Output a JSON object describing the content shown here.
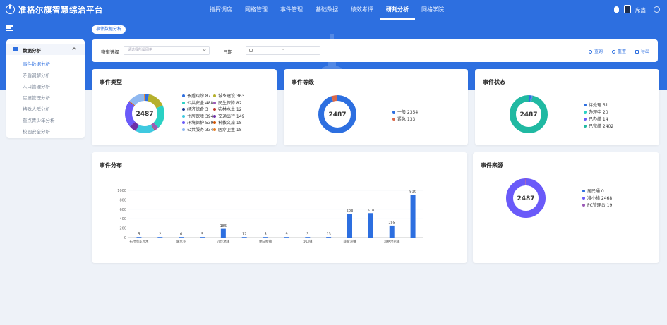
{
  "header": {
    "title": "准格尔旗智慧综治平台",
    "nav": [
      "指挥调度",
      "网格管理",
      "事件管理",
      "基础数据",
      "绩效考评",
      "研判分析",
      "网格学院"
    ],
    "active_nav": "研判分析",
    "user_name": "席鑫"
  },
  "breadcrumb": {
    "tab": "事件数据分析"
  },
  "sidebar": {
    "group": "数据分析",
    "items": [
      {
        "label": "事件数据分析",
        "active": true
      },
      {
        "label": "矛盾调解分析",
        "active": false
      },
      {
        "label": "人口管理分析",
        "active": false
      },
      {
        "label": "房屋管理分析",
        "active": false
      },
      {
        "label": "特殊人群分析",
        "active": false
      },
      {
        "label": "重点青少年分析",
        "active": false
      },
      {
        "label": "校园安全分析",
        "active": false
      }
    ]
  },
  "filter": {
    "street_label": "街道选择",
    "street_placeholder": "请选择所属网格",
    "date_label": "日期",
    "date_separator": "-",
    "query_label": "查询",
    "reset_label": "重置",
    "export_label": "导出"
  },
  "colors": {
    "primary": "#2d6fe0",
    "band": "#2d6fe0"
  },
  "cards": {
    "type_title": "事件类型",
    "level_title": "事件等级",
    "status_title": "事件状态",
    "dist_title": "事件分布",
    "source_title": "事件来源"
  },
  "chart_data": [
    {
      "type": "pie",
      "title": "事件类型",
      "total": "2487",
      "slices": [
        {
          "name": "矛盾纠纷",
          "value": 87,
          "label": "矛盾纠纷 87",
          "color": "#2d6fe0"
        },
        {
          "name": "城乡建设",
          "value": 363,
          "label": "城乡建设 363",
          "color": "#b5b02c"
        },
        {
          "name": "公共安全",
          "value": 488,
          "label": "公共安全 488",
          "color": "#2ad1c4"
        },
        {
          "name": "民生保障",
          "value": 82,
          "label": "民生保障 82",
          "color": "#9b59b6"
        },
        {
          "name": "经济综合",
          "value": 3,
          "label": "经济综合 3",
          "color": "#1f3a93"
        },
        {
          "name": "农林水土",
          "value": 12,
          "label": "农林水土 12",
          "color": "#c0392b"
        },
        {
          "name": "住房保障",
          "value": 394,
          "label": "住房保障 394",
          "color": "#3fc9e0"
        },
        {
          "name": "交通出行",
          "value": 149,
          "label": "交通出行 149",
          "color": "#6d2fa8"
        },
        {
          "name": "环境保护",
          "value": 539,
          "label": "环境保护 539",
          "color": "#6a5af9"
        },
        {
          "name": "科教文旅",
          "value": 18,
          "label": "科教文旅 18",
          "color": "#d35400"
        },
        {
          "name": "公共服务",
          "value": 334,
          "label": "公共服务 334",
          "color": "#8fb8f0"
        },
        {
          "name": "医疗卫生",
          "value": 18,
          "label": "医疗卫生 18",
          "color": "#e67e22"
        }
      ]
    },
    {
      "type": "pie",
      "title": "事件等级",
      "total": "2487",
      "slices": [
        {
          "name": "一般",
          "value": 2354,
          "label": "一般 2354",
          "color": "#2d6fe0"
        },
        {
          "name": "紧急",
          "value": 133,
          "label": "紧急 133",
          "color": "#d9694a"
        }
      ]
    },
    {
      "type": "pie",
      "title": "事件状态",
      "total": "2487",
      "slices": [
        {
          "name": "待处理",
          "value": 51,
          "label": "待处理 51",
          "color": "#2d6fe0"
        },
        {
          "name": "办理中",
          "value": 20,
          "label": "办理中 20",
          "color": "#2ad1c4"
        },
        {
          "name": "已办结",
          "value": 14,
          "label": "已办结 14",
          "color": "#6a5af9"
        },
        {
          "name": "已完结",
          "value": 2402,
          "label": "已完结 2402",
          "color": "#20b9a2"
        }
      ]
    },
    {
      "type": "bar",
      "title": "事件分布",
      "categories": [
        "布尔陶亥苏木",
        "",
        "暖水乡",
        "",
        "沙圪堵镇",
        "",
        "纳日松镇",
        "",
        "龙口镇",
        "",
        "薛家湾镇",
        "",
        "准格尔召镇",
        ""
      ],
      "tick_labels": [
        "布尔陶亥苏木",
        "暖水乡",
        "沙圪堵镇",
        "纳日松镇",
        "龙口镇",
        "薛家湾镇",
        "准格尔召镇"
      ],
      "values": [
        5,
        2,
        6,
        5,
        185,
        12,
        5,
        9,
        3,
        13,
        503,
        518,
        255,
        910
      ],
      "yticks": [
        "1000",
        "800",
        "600",
        "400",
        "200",
        "0"
      ],
      "ylim": [
        0,
        1000
      ],
      "color": "#2d6fe0"
    },
    {
      "type": "pie",
      "title": "事件来源",
      "total": "2487",
      "slices": [
        {
          "name": "居民通",
          "value": 0,
          "label": "居民通 0",
          "color": "#2d6fe0"
        },
        {
          "name": "准小格",
          "value": 2468,
          "label": "准小格 2468",
          "color": "#6a5af9"
        },
        {
          "name": "PC管理台",
          "value": 19,
          "label": "PC管理台 19",
          "color": "#9b59b6"
        }
      ]
    }
  ]
}
